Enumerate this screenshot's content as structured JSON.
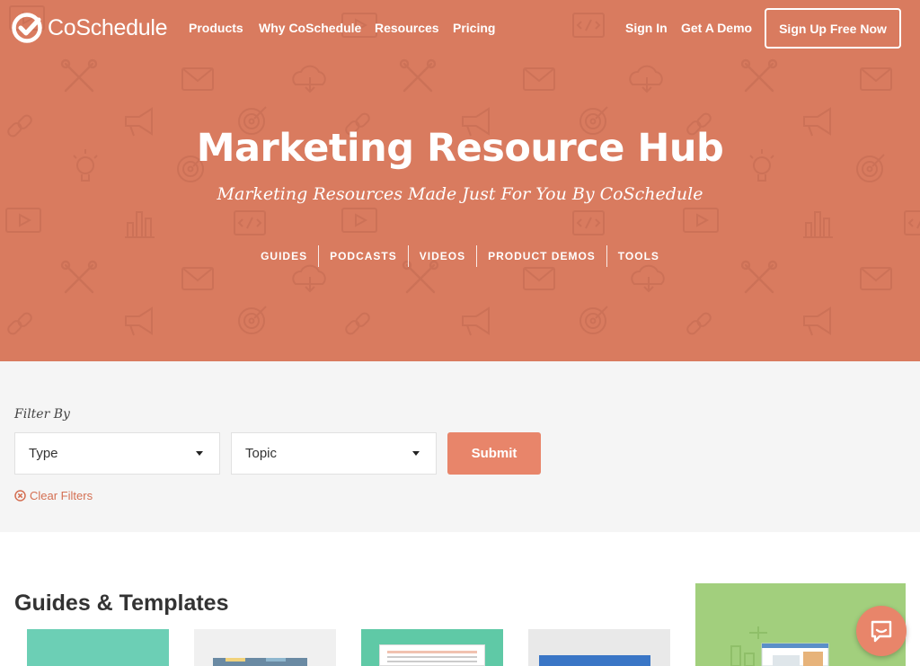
{
  "brand": {
    "logo_text": "CoSchedule",
    "primary_color": "#d97b5f",
    "accent_color": "#e8856a"
  },
  "nav": {
    "items": [
      {
        "label": "Products"
      },
      {
        "label": "Why CoSchedule"
      },
      {
        "label": "Resources"
      },
      {
        "label": "Pricing"
      }
    ],
    "sign_in": "Sign In",
    "demo": "Get A Demo",
    "signup": "Sign Up Free Now"
  },
  "hero": {
    "title": "Marketing Resource Hub",
    "subtitle": "Marketing Resources Made Just For You By CoSchedule",
    "tabs": [
      {
        "label": "GUIDES"
      },
      {
        "label": "PODCASTS"
      },
      {
        "label": "VIDEOS"
      },
      {
        "label": "PRODUCT DEMOS"
      },
      {
        "label": "TOOLS"
      }
    ],
    "background_icons": [
      "envelope-icon",
      "wrench-icon",
      "cloud-download-icon",
      "megaphone-icon",
      "lightbulb-icon",
      "target-icon",
      "bar-chart-icon",
      "video-player-icon",
      "code-icon",
      "link-icon"
    ]
  },
  "filters": {
    "label": "Filter By",
    "type": {
      "value": "Type"
    },
    "topic": {
      "value": "Topic"
    },
    "submit": "Submit",
    "clear": "Clear Filters"
  },
  "guides": {
    "title": "Guides & Templates"
  },
  "chat": {
    "icon": "chat-bubble-icon"
  }
}
